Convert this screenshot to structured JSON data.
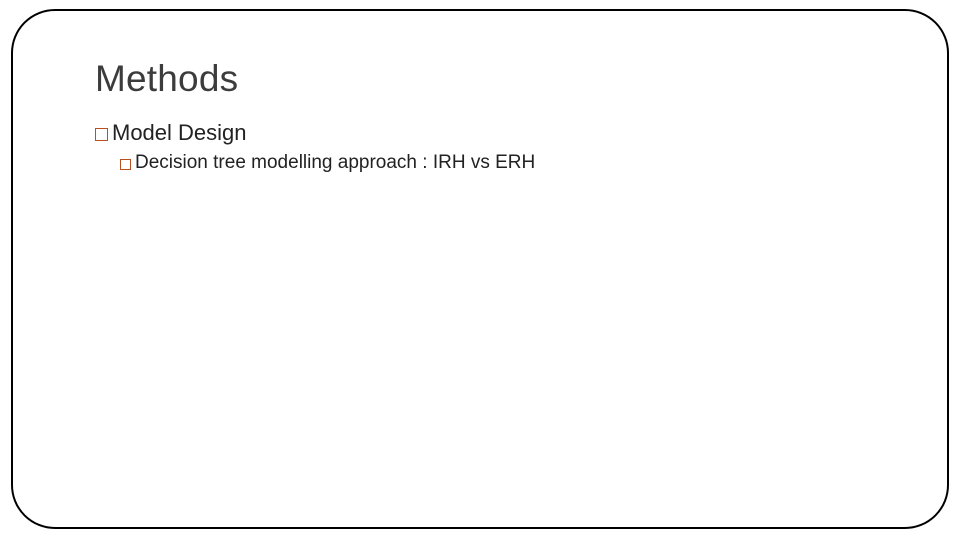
{
  "slide": {
    "title": "Methods",
    "bullets": {
      "l1": "Model Design",
      "l2": "Decision tree modelling approach : IRH vs ERH"
    }
  }
}
